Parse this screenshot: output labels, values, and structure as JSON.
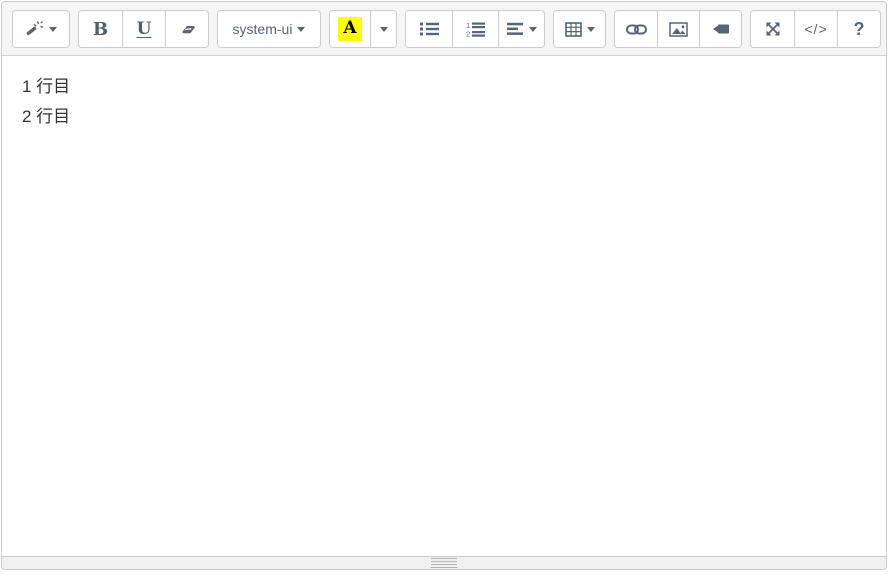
{
  "toolbar": {
    "style_group": {
      "magic_icon": "magic-wand-icon",
      "has_dropdown": true
    },
    "font_group": {
      "bold_label": "B",
      "underline_label": "U",
      "clear_icon": "eraser-icon"
    },
    "fontname_group": {
      "selected_font": "system-ui"
    },
    "color_group": {
      "recent_color_label": "A",
      "highlight_color": "#ffff00",
      "foreground_color": "#000000"
    },
    "para_group": {
      "ul_icon": "unordered-list-icon",
      "ol_icon": "ordered-list-icon",
      "align_icon": "paragraph-align-icon"
    },
    "table_group": {
      "table_icon": "table-icon"
    },
    "insert_group": {
      "link_icon": "link-icon",
      "picture_icon": "picture-icon",
      "video_icon": "video-icon"
    },
    "view_group": {
      "fullscreen_icon": "arrows-expand-icon",
      "codeview_label": "</>",
      "help_label": "?"
    }
  },
  "editor": {
    "lines": [
      "1 行目",
      "2 行目"
    ]
  },
  "colors": {
    "toolbar_bg": "#f5f5f5",
    "statusbar_bg": "#f0f0f0",
    "frame_border": "#c9c9c9",
    "button_border": "#cccccc",
    "icon_color": "#546577",
    "text_color": "#333333",
    "highlight": "#ffff00"
  }
}
